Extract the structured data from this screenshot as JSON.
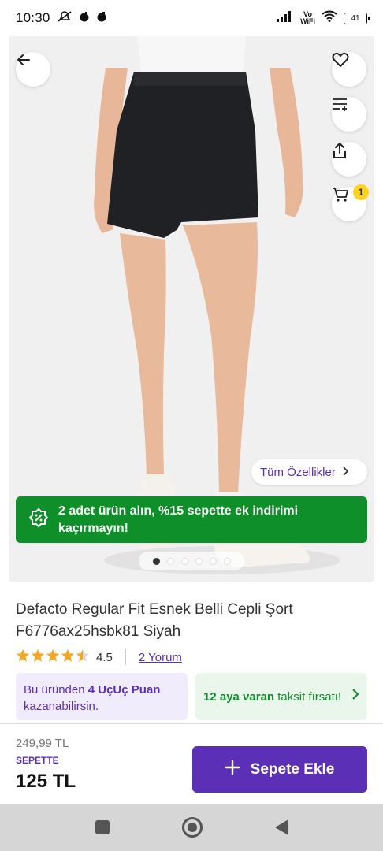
{
  "status_bar": {
    "time": "10:30",
    "network_label": "Vo\nWiFi",
    "battery": "41"
  },
  "gallery": {
    "features_label": "Tüm Özellikler",
    "cart_count": "1",
    "dots_count": 6,
    "active_dot": 0,
    "icons": [
      "back-arrow-icon",
      "heart-icon",
      "filter-icon",
      "share-icon",
      "cart-icon"
    ]
  },
  "promo": {
    "text": "2 adet ürün alın, %15 sepette ek indirimi kaçırmayın!"
  },
  "product": {
    "title": "Defacto Regular Fit Esnek Belli Cepli Şort F6776ax25hsbk81 Siyah",
    "rating": "4.5",
    "reviews_label": "2 Yorum"
  },
  "points_card": {
    "prefix": "Bu üründen ",
    "highlight": "4 UçUç Puan",
    "suffix": " kazanabilirsin."
  },
  "installment_card": {
    "highlight": "12 aya varan",
    "suffix": " taksit fırsatı!"
  },
  "purchase": {
    "old_price": "249,99 TL",
    "basket_label": "SEPETTE",
    "price": "125 TL",
    "add_button_label": "Sepete Ekle"
  },
  "colors": {
    "accent": "#5b2fb6",
    "promo_green": "#0e8f2a",
    "badge_yellow": "#ffd21f"
  }
}
